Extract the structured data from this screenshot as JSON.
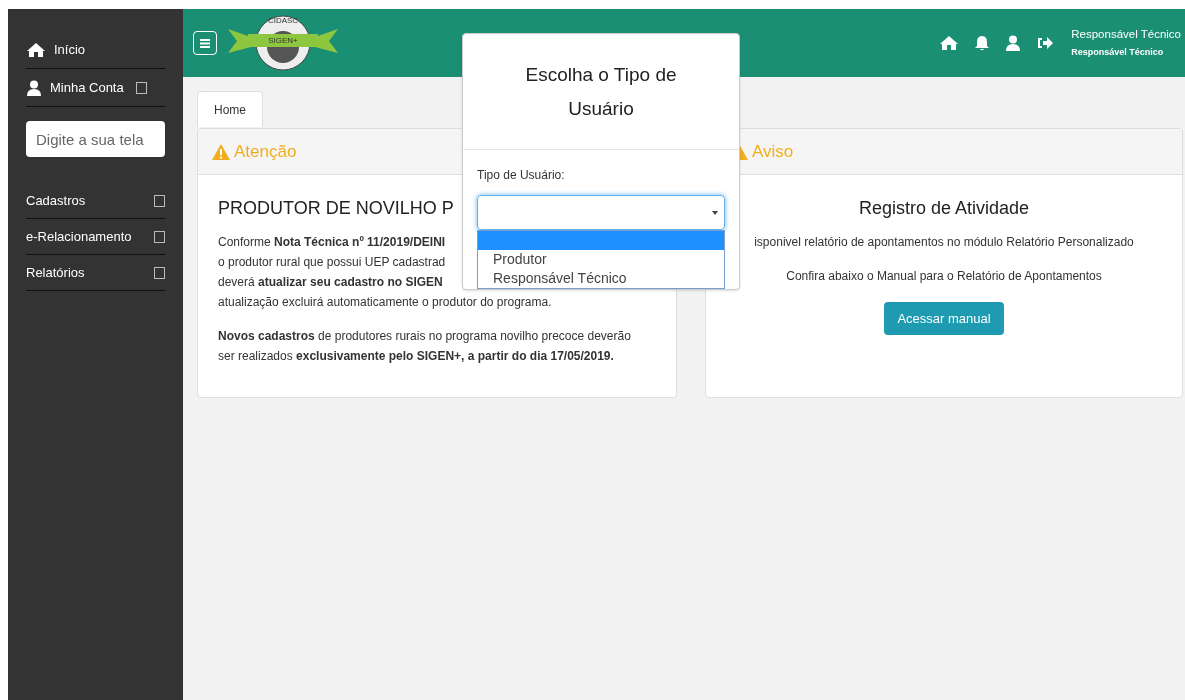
{
  "sidebar": {
    "items": [
      {
        "label": "Início",
        "expandable": false
      },
      {
        "label": "Minha Conta",
        "expandable": true
      }
    ],
    "search": {
      "placeholder": "Digite a sua tela"
    },
    "menu": [
      {
        "label": "Cadastros"
      },
      {
        "label": "e-Relacionamento"
      },
      {
        "label": "Relatórios"
      }
    ]
  },
  "header": {
    "logo": {
      "top": "CIDASC",
      "band": "SIGEN+"
    },
    "user_name": "Responsável Técnico",
    "user_role": "Responsável Técnico"
  },
  "tabs": [
    {
      "label": "Home",
      "selected": true
    }
  ],
  "cards": [
    {
      "title": "Atenção",
      "heading": "PRODUTOR DE NOVILHO P",
      "lines": [
        "Conforme **Nota Técnica nº 11/2019/DEINI**",
        "o produtor rural que possui UEP cadastrad",
        "deverá **atualizar seu cadastro no SIGEN**",
        "atualização excluirá automaticamente o produtor do programa."
      ],
      "paragraph": "**Novos cadastros** de produtores rurais no programa novilho precoce deverão ser realizados **exclusivamente pelo SIGEN+, a partir do dia 17/05/2019.**"
    },
    {
      "title": "Aviso",
      "heading": "Registro de Atividade",
      "lines": [
        "isponivel relatório de apontamentos no módulo Relatório Personalizado",
        "Confira abaixo o Manual para o Relatório de Apontamentos"
      ],
      "button": "Acessar manual"
    }
  ],
  "modal": {
    "title": "Escolha o Tipo de Usuário",
    "field_label": "Tipo de Usuário:",
    "options": [
      {
        "selected": true
      },
      {
        "label": "Produtor",
        "selected": false
      },
      {
        "label": "Responsável Técnico",
        "selected": false
      }
    ]
  }
}
